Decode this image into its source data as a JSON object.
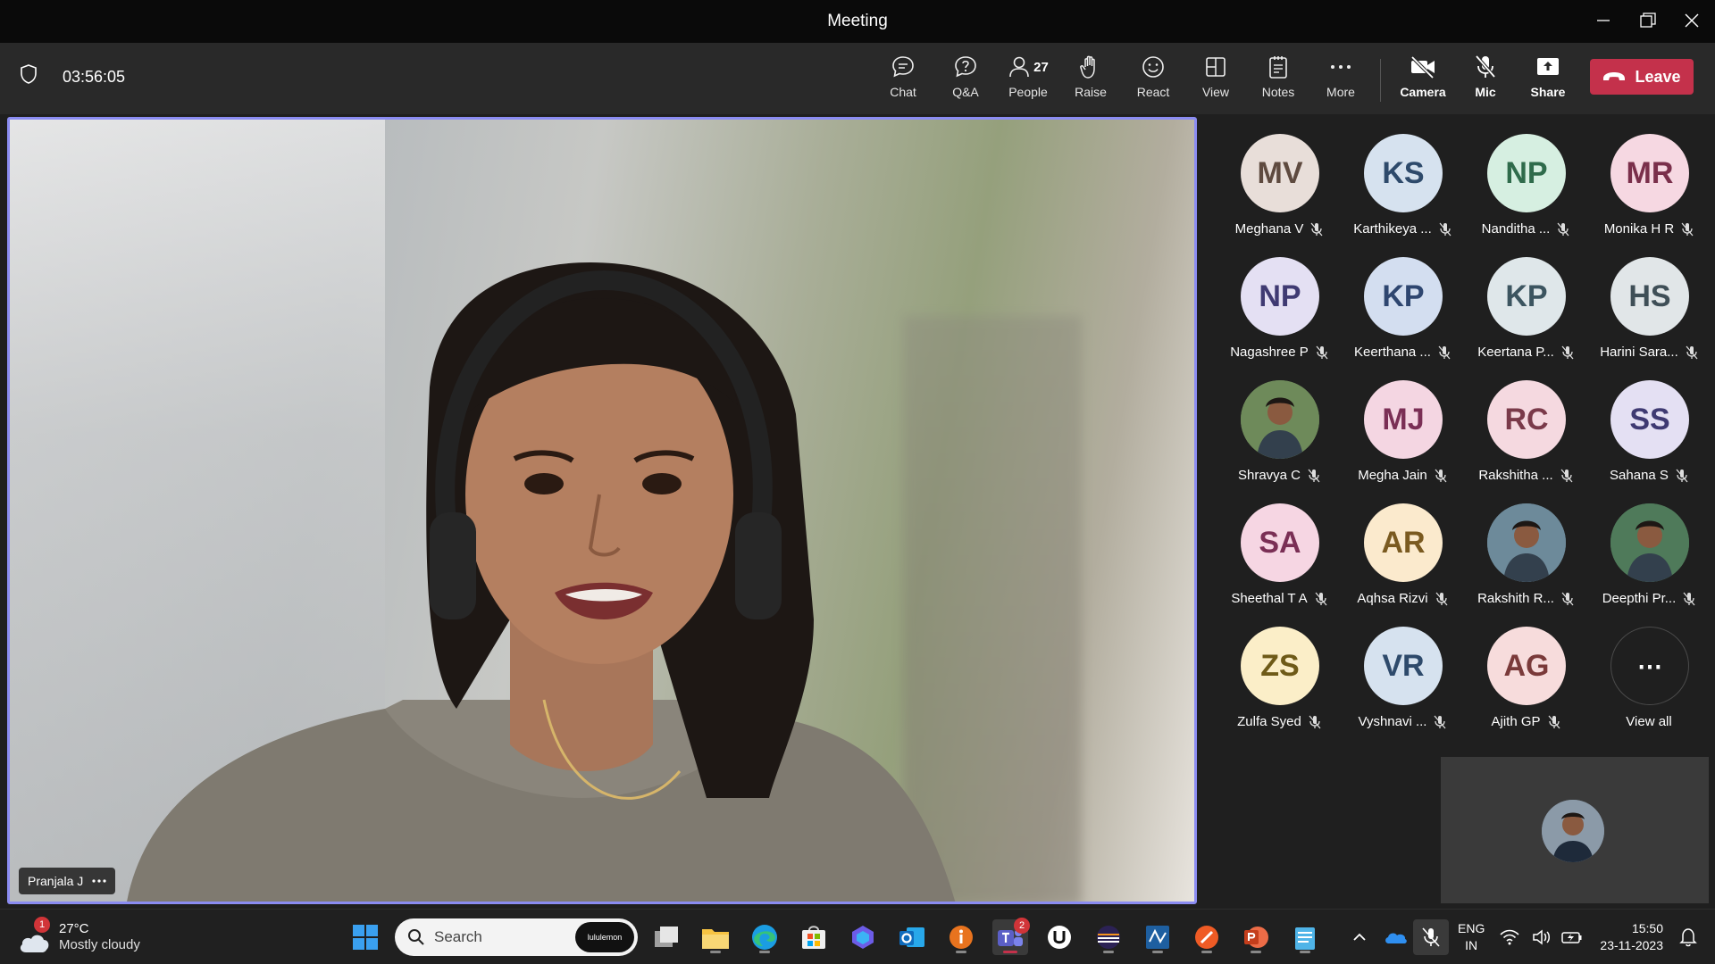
{
  "window": {
    "title": "Meeting"
  },
  "toolbar": {
    "timer": "03:56:05",
    "buttons": {
      "chat": "Chat",
      "qa": "Q&A",
      "people": "People",
      "people_count": "27",
      "raise": "Raise",
      "react": "React",
      "view": "View",
      "notes": "Notes",
      "more": "More",
      "camera": "Camera",
      "mic": "Mic",
      "share": "Share",
      "leave": "Leave"
    }
  },
  "stage": {
    "speaker_name": "Pranjala J",
    "accent_color": "#8b8cf2"
  },
  "participants": [
    {
      "initials": "MV",
      "name": "Meghana V",
      "color": "#e8ded9",
      "text": "#5e4a3f"
    },
    {
      "initials": "KS",
      "name": "Karthikeya ...",
      "color": "#d6e2ef",
      "text": "#2e4a6b"
    },
    {
      "initials": "NP",
      "name": "Nanditha ...",
      "color": "#d6efe1",
      "text": "#2f6b4b"
    },
    {
      "initials": "MR",
      "name": "Monika H R",
      "color": "#f6d8e2",
      "text": "#7a2f4b"
    },
    {
      "initials": "NP",
      "name": "Nagashree P",
      "color": "#e4e0f3",
      "text": "#3f3a72"
    },
    {
      "initials": "KP",
      "name": "Keerthana ...",
      "color": "#d3def0",
      "text": "#2e4670"
    },
    {
      "initials": "KP",
      "name": "Keertana P...",
      "color": "#dfe7ea",
      "text": "#3c5560"
    },
    {
      "initials": "HS",
      "name": "Harini Sara...",
      "color": "#e1e6e8",
      "text": "#3f4f57"
    },
    {
      "initials": "",
      "name": "Shravya C",
      "color": "#6e8a5a",
      "text": "#ffffff"
    },
    {
      "initials": "MJ",
      "name": "Megha Jain",
      "color": "#f4d6e2",
      "text": "#7a2f55"
    },
    {
      "initials": "RC",
      "name": "Rakshitha ...",
      "color": "#f5d9e0",
      "text": "#7a3a4a"
    },
    {
      "initials": "SS",
      "name": "Sahana S",
      "color": "#e4e0f3",
      "text": "#3f3a72"
    },
    {
      "initials": "SA",
      "name": "Sheethal T A",
      "color": "#f6d6e3",
      "text": "#7a2f55"
    },
    {
      "initials": "AR",
      "name": "Aqhsa Rizvi",
      "color": "#fbeacd",
      "text": "#7a5a20"
    },
    {
      "initials": "",
      "name": "Rakshith R...",
      "color": "#6d8a9a",
      "text": "#ffffff"
    },
    {
      "initials": "",
      "name": "Deepthi Pr...",
      "color": "#4f7a5a",
      "text": "#ffffff"
    },
    {
      "initials": "ZS",
      "name": "Zulfa Syed",
      "color": "#fbeec8",
      "text": "#6e5a18"
    },
    {
      "initials": "VR",
      "name": "Vyshnavi ...",
      "color": "#d6e2ef",
      "text": "#2e4a6b"
    },
    {
      "initials": "AG",
      "name": "Ajith GP",
      "color": "#f7dcdc",
      "text": "#7a3a3a"
    }
  ],
  "view_all": {
    "label": "View all",
    "icon": "⋯"
  },
  "taskbar": {
    "weather": {
      "temp": "27°C",
      "condition": "Mostly cloudy",
      "badge": "1"
    },
    "search_placeholder": "Search",
    "search_promo": "lululemon",
    "teams_badge": "2",
    "lang_line1": "ENG",
    "lang_line2": "IN",
    "time": "15:50",
    "date": "23-11-2023"
  }
}
